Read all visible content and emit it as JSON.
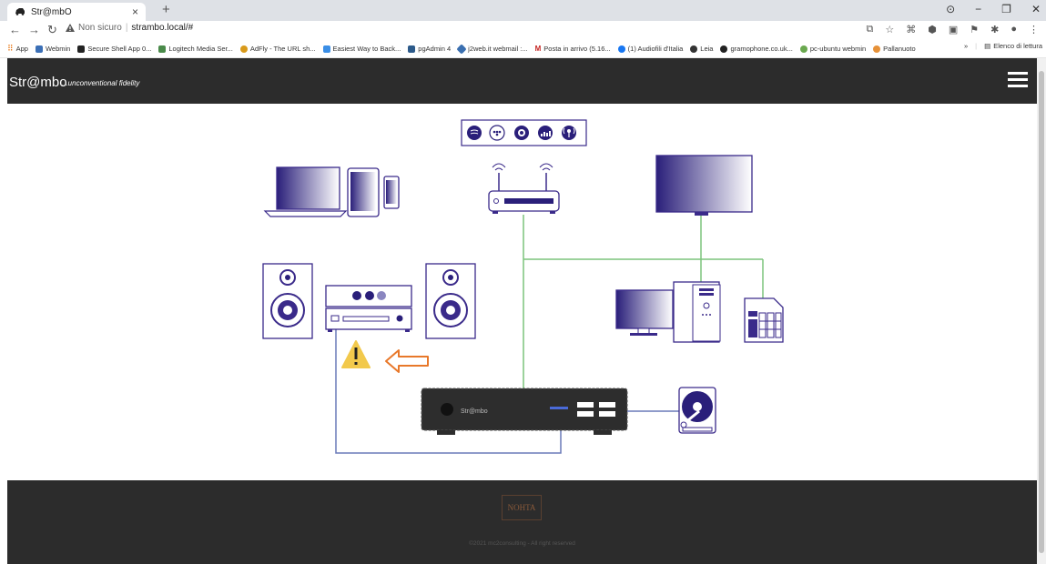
{
  "browser": {
    "tab_title": "Str@mbO",
    "tab_close": "×",
    "new_tab": "+",
    "security_label": "Non sicuro",
    "url": "strambo.local/#",
    "window_controls": [
      "⊙",
      "−",
      "❐",
      "✕"
    ]
  },
  "bookmarks": [
    {
      "label": "App",
      "color": "#e8710a"
    },
    {
      "label": "Webmin",
      "color": "#3b6fb6"
    },
    {
      "label": "Secure Shell App 0...",
      "color": "#222222"
    },
    {
      "label": "Logitech Media Ser...",
      "color": "#4a8a4a"
    },
    {
      "label": "AdFly - The URL sh...",
      "color": "#d99a1a"
    },
    {
      "label": "Easiest Way to Back...",
      "color": "#3a8ee6"
    },
    {
      "label": "pgAdmin 4",
      "color": "#2c5a8a"
    },
    {
      "label": "j2web.it webmail :...",
      "color": "#3a6fb0"
    },
    {
      "label": "Posta in arrivo (5.16...",
      "color": "#c5221f"
    },
    {
      "label": "(1) Audiofili d'Italia",
      "color": "#1877f2"
    },
    {
      "label": "Leia",
      "color": "#333333"
    },
    {
      "label": "gramophone.co.uk...",
      "color": "#222222"
    },
    {
      "label": "pc-ubuntu webmin",
      "color": "#6aa84f"
    },
    {
      "label": "Pallanuoto",
      "color": "#e69138"
    }
  ],
  "bookmarks_more": "»",
  "reading_list": "Elenco di lettura",
  "navbar": {
    "brand": "Str@mbo",
    "tagline": "...unconventional fidelity"
  },
  "diagram": {
    "device_label": "Str@mbo",
    "accent_color": "#3a2a8a",
    "line_color": "#7cc47c",
    "cable_color": "#6a7ab8",
    "warning_color": "#f2c94c",
    "arrow_color": "#e8782a",
    "service_icons": [
      "spotify-icon",
      "tidal-icon",
      "qobuz-icon",
      "deezer-icon",
      "radio-icon"
    ]
  },
  "footer": {
    "logo_text": "NOHTA",
    "copyright": "©2021 mc2consulting - All right reserved"
  }
}
